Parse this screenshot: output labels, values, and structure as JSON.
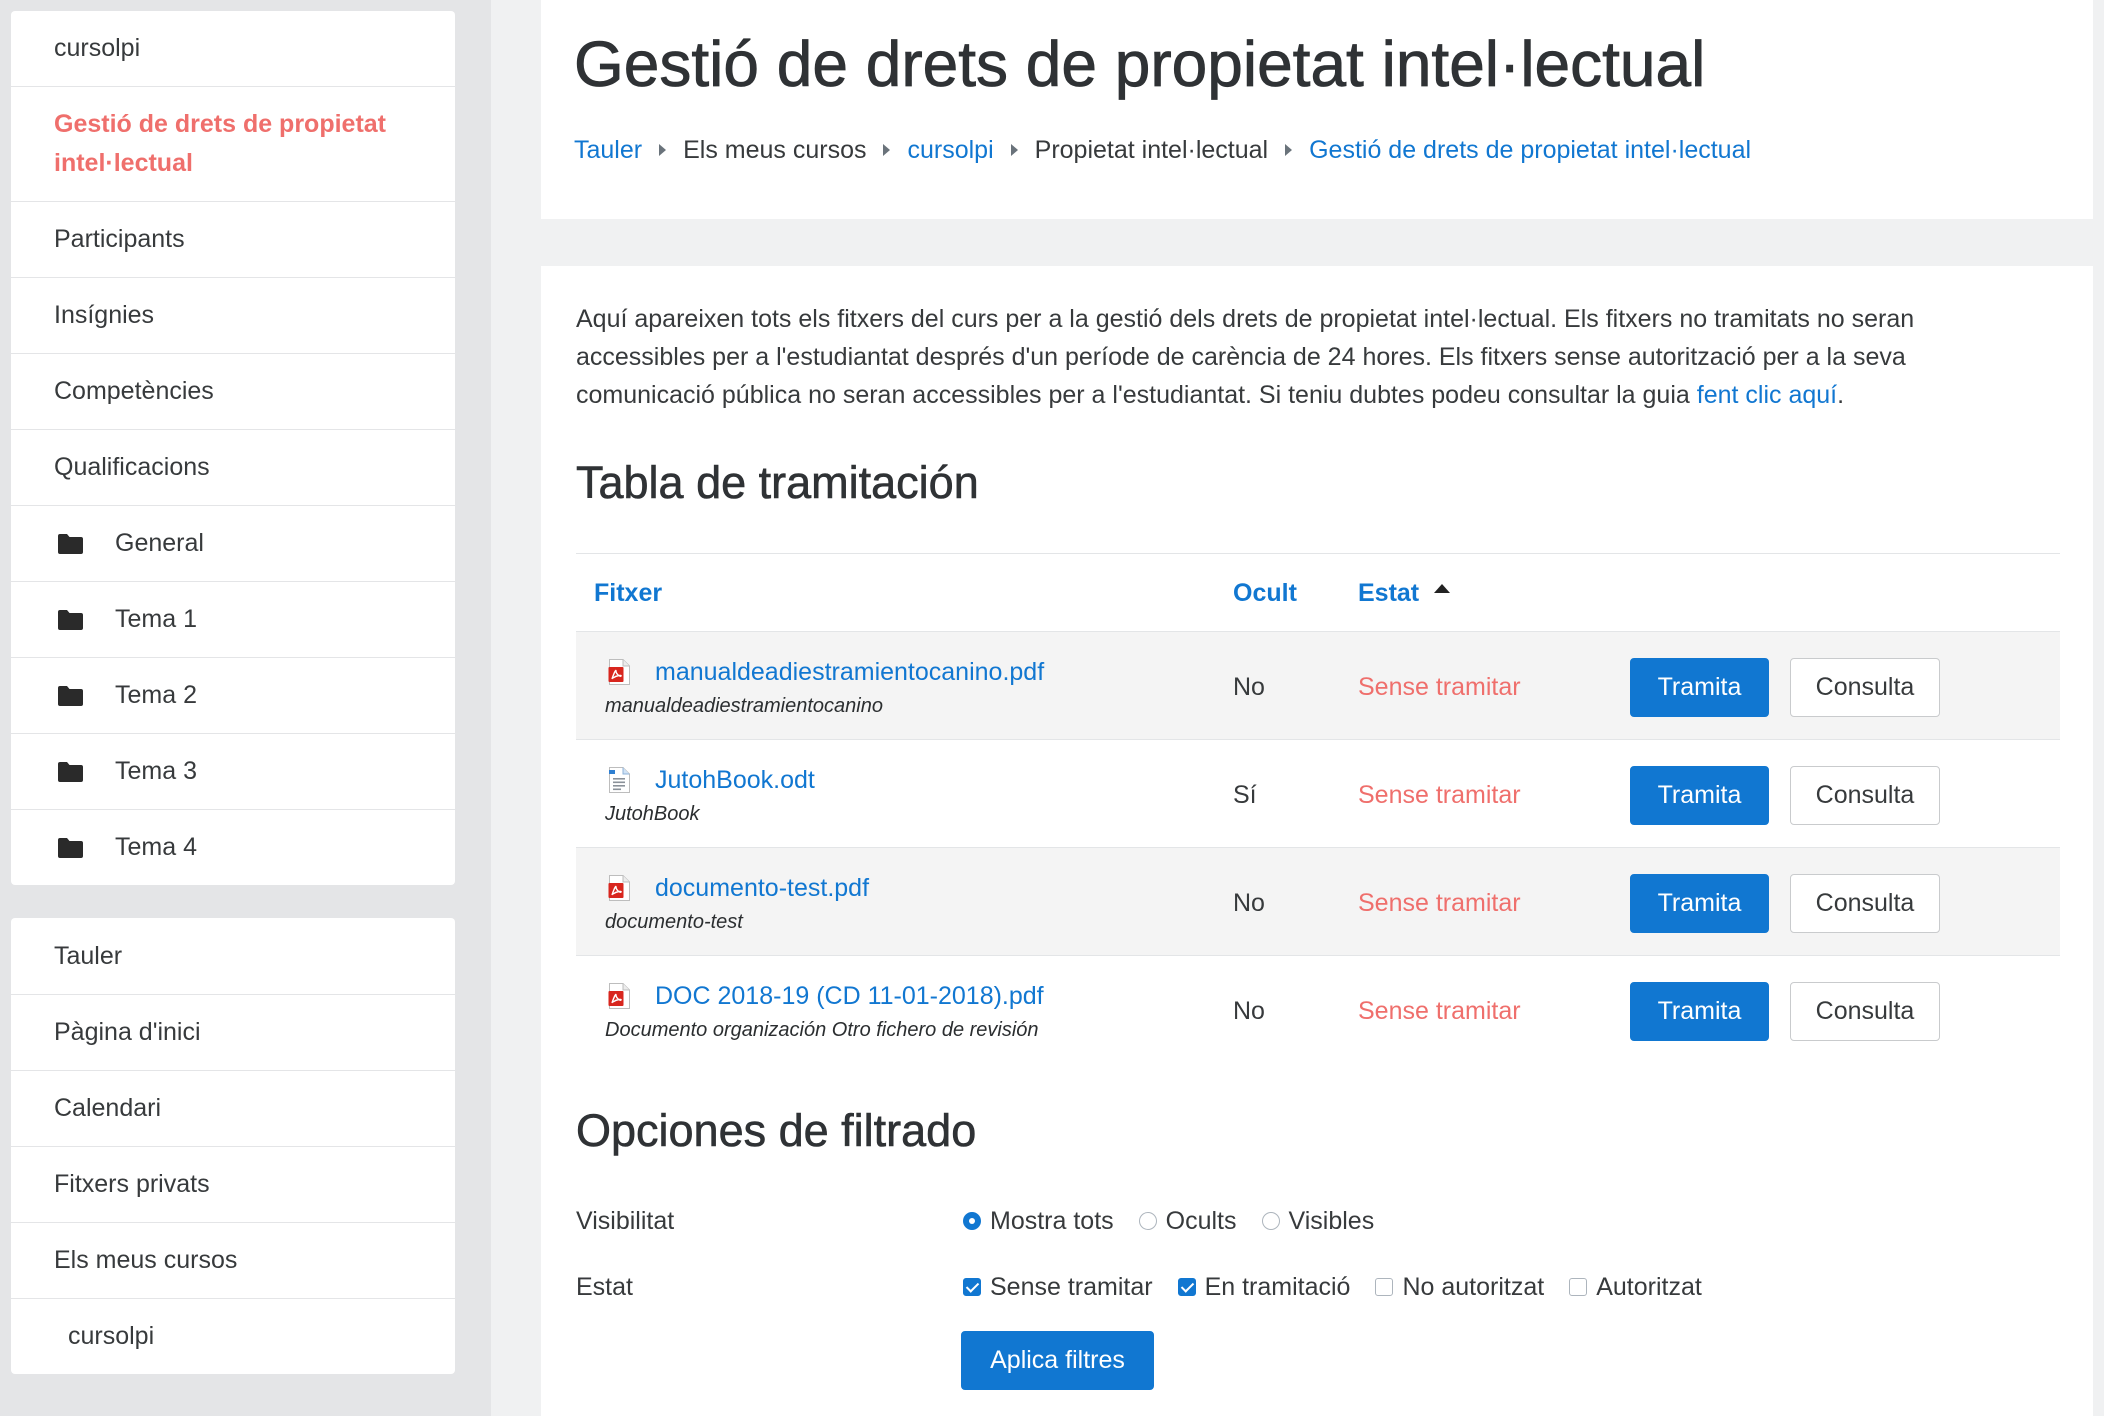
{
  "sidebar": {
    "course_nav": {
      "course": "cursolpi",
      "active": "Gestió de drets de propietat intel·lectual",
      "items": [
        "Participants",
        "Insígnies",
        "Competències",
        "Qualificacions"
      ],
      "section_icon": "folder-icon",
      "sections": [
        "General",
        "Tema 1",
        "Tema 2",
        "Tema 3",
        "Tema 4"
      ]
    },
    "site_nav": {
      "items": [
        "Tauler",
        "Pàgina d'inici",
        "Calendari",
        "Fitxers privats",
        "Els meus cursos"
      ],
      "courses": [
        "cursolpi"
      ]
    }
  },
  "header": {
    "title": "Gestió de drets de propietat intel·lectual",
    "breadcrumb_separator_icon": "chevron-right-icon",
    "breadcrumb": [
      "Tauler",
      "Els meus cursos",
      "cursolpi",
      "Propietat intel·lectual",
      "Gestió de drets de propietat intel·lectual"
    ]
  },
  "intro": {
    "text": "Aquí apareixen tots els fitxers del curs per a la gestió dels drets de propietat intel·lectual. Els fitxers no tramitats no seran accessibles per a l'estudiantat després d'un període de carència de 24 hores. Els fitxers sense autorització per a la seva comunicació pública no seran accessibles per a l'estudiantat. Si teniu dubtes podeu consultar la guia",
    "link": "fent clic aquí",
    "end": "."
  },
  "table": {
    "heading": "Tabla de tramitación",
    "columns": {
      "file": "Fitxer",
      "hidden": "Ocult",
      "status": "Estat"
    },
    "sort_icon": "sort-ascending-icon",
    "actions": {
      "process": "Tramita",
      "view": "Consulta"
    },
    "rows": [
      {
        "icon": "pdf-icon",
        "file": "manualdeadiestramientocanino.pdf",
        "title": "manualdeadiestramientocanino",
        "hidden": "No",
        "status": "Sense tramitar"
      },
      {
        "icon": "odt-icon",
        "file": "JutohBook.odt",
        "title": "JutohBook",
        "hidden": "Sí",
        "status": "Sense tramitar"
      },
      {
        "icon": "pdf-icon",
        "file": "documento-test.pdf",
        "title": "documento-test",
        "hidden": "No",
        "status": "Sense tramitar"
      },
      {
        "icon": "pdf-icon",
        "file": "DOC 2018-19 (CD 11-01-2018).pdf",
        "title": "Documento organización Otro fichero de revisión",
        "hidden": "No",
        "status": "Sense tramitar"
      }
    ]
  },
  "filters": {
    "heading": "Opciones de filtrado",
    "visibility": {
      "label": "Visibilitat",
      "options": [
        {
          "label": "Mostra tots",
          "selected": true
        },
        {
          "label": "Ocults",
          "selected": false
        },
        {
          "label": "Visibles",
          "selected": false
        }
      ]
    },
    "status": {
      "label": "Estat",
      "options": [
        {
          "label": "Sense tramitar",
          "checked": true
        },
        {
          "label": "En tramitació",
          "checked": true
        },
        {
          "label": "No autoritzat",
          "checked": false
        },
        {
          "label": "Autoritzat",
          "checked": false
        }
      ]
    },
    "apply": "Aplica filtres"
  },
  "colors": {
    "primary": "#1177d1",
    "danger": "#ef6f6c",
    "text": "#373a3c"
  }
}
